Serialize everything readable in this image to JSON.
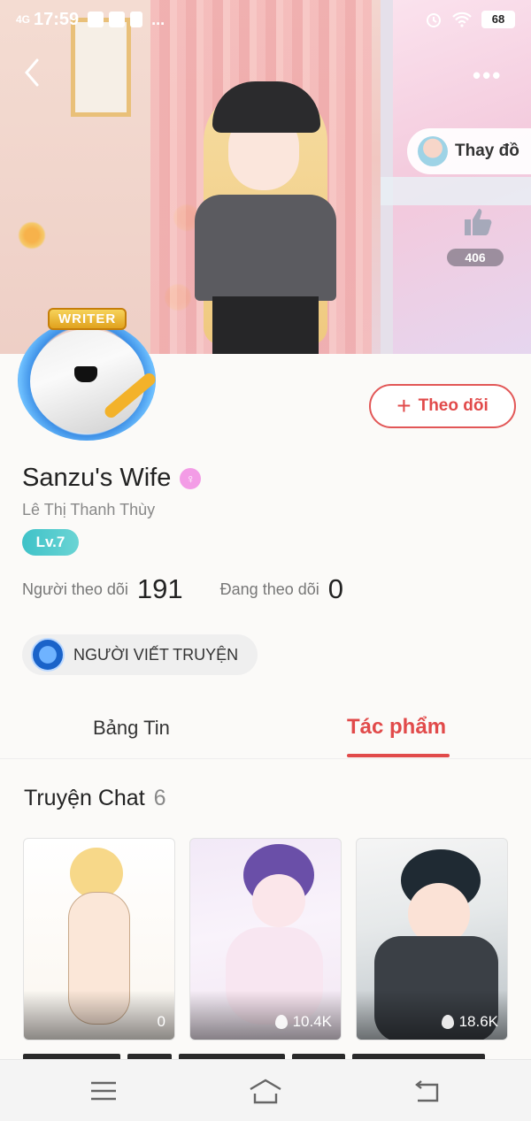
{
  "status_bar": {
    "network": "4G",
    "time": "17:59",
    "more": "...",
    "battery": "68"
  },
  "cover": {
    "more_label": "•••",
    "theme_button_label": "Thay đồ",
    "like_count": "406"
  },
  "profile": {
    "badge": "WRITER",
    "display_name": "Sanzu's Wife",
    "real_name": "Lê Thị Thanh Thùy",
    "level": "Lv.7",
    "follow_label": "Theo dõi",
    "followers_label": "Người theo dõi",
    "followers_count": "191",
    "following_label": "Đang theo dõi",
    "following_count": "0",
    "role": "NGƯỜI VIẾT TRUYỆN"
  },
  "tabs": [
    {
      "label": "Bảng Tin",
      "active": false
    },
    {
      "label": "Tác phẩm",
      "active": true
    }
  ],
  "section": {
    "title": "Truyện Chat",
    "count": "6"
  },
  "stories": [
    {
      "views": "0"
    },
    {
      "views": "10.4K"
    },
    {
      "views": "18.6K"
    }
  ],
  "colors": {
    "accent": "#e14a4a",
    "level": "#3fc2c8",
    "role_icon": "#1a63c9"
  }
}
